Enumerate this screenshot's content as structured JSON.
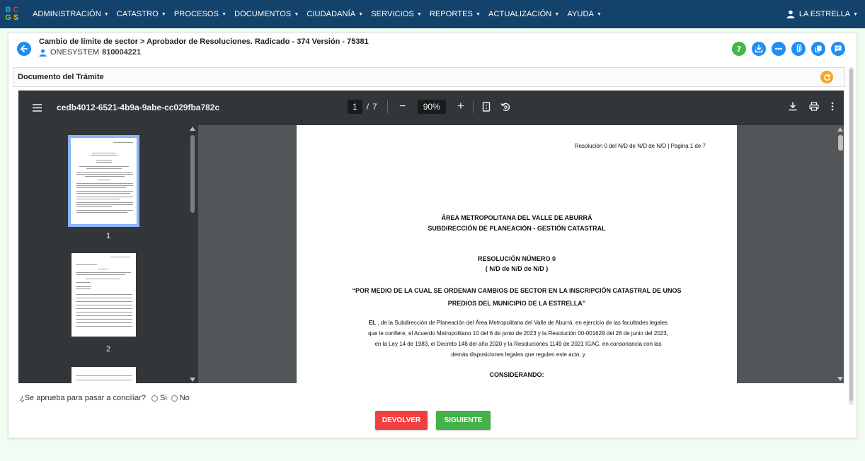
{
  "app": {
    "logo_letters": [
      "B",
      "C",
      "G",
      "S"
    ],
    "colors": {
      "nav_bg": "#13426b",
      "accent_blue": "#1e90f5",
      "green": "#46b04a",
      "red": "#ef3f3f",
      "orange": "#f5a623",
      "page_bg": "#f1fdf2"
    }
  },
  "nav": {
    "items": [
      {
        "label": "ADMINISTRACIÓN"
      },
      {
        "label": "CATASTRO"
      },
      {
        "label": "PROCESOS"
      },
      {
        "label": "DOCUMENTOS"
      },
      {
        "label": "CIUDADANÍA"
      },
      {
        "label": "SERVICIOS"
      },
      {
        "label": "REPORTES"
      },
      {
        "label": "ACTUALIZACIÓN"
      },
      {
        "label": "AYUDA"
      }
    ],
    "user_label": "LA ESTRELLA"
  },
  "header": {
    "title": "Cambio de límite de sector > Aprobador de Resoluciones. Radicado - 374 Versión - 75381",
    "user_name": "ONESYSTEM",
    "user_id": "810004221",
    "action_icons": [
      "help-icon",
      "download-icon",
      "more-icon",
      "attachment-icon",
      "copy-icon",
      "comment-icon"
    ]
  },
  "section": {
    "title": "Documento del Trámite"
  },
  "viewer": {
    "doc_name": "cedb4012-6521-4b9a-9abe-cc029fba782c",
    "current_page": "1",
    "page_sep": "/",
    "total_pages": "7",
    "zoom": "90%",
    "thumbnails": [
      {
        "number": "1",
        "selected": true
      },
      {
        "number": "2",
        "selected": false
      }
    ]
  },
  "page": {
    "header_text": "Resolución 0 del N/D de N/D de N/D | Pagina 1 de 7",
    "org_line1": "ÁREA METROPOLITANA DEL VALLE DE ABURRÁ",
    "org_line2": "SUBDIRECCIÓN DE PLANEACIÓN - GESTIÓN CATASTRAL",
    "res_number": "RESOLUCIÓN NÚMERO 0",
    "res_date": "( N/D de N/D de N/D )",
    "subject_line1": "“POR MEDIO DE LA CUAL SE ORDENAN CAMBIOS DE SECTOR EN LA INSCRIPCIÓN CATASTRAL DE UNOS",
    "subject_line2": "PREDIOS DEL MUNICIPIO DE LA ESTRELLA”",
    "body_lead": "EL",
    "body_line1": " , de la Subdirección de Planeación del Área Metropolitana del Valle de Aburrá, en ejercicio de las facultades legales",
    "body_line2": "que le confiere, el Acuerdo Metropolitano 10 del 6 de junio de 2023 y la Resolución 00-001629 del 26 de junio del 2023,",
    "body_line3": "en la Ley 14 de 1983, el Decreto 148 del año 2020 y la Resoluciones 1149 de 2021 IGAC, en consonancia con las",
    "body_line4": "demás disposiciones legales que regulen este acto, y",
    "considerando": "CONSIDERANDO:"
  },
  "form": {
    "question": "¿Se aprueba para pasar a conciliar?",
    "option_yes": "Si",
    "option_no": "No",
    "btn_return": "DEVOLVER",
    "btn_next": "SIGUIENTE"
  }
}
